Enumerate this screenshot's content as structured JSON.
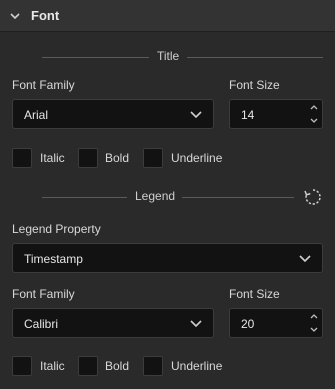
{
  "section": {
    "title": "Font"
  },
  "title_group": {
    "heading": "Title",
    "font_family_label": "Font Family",
    "font_family_value": "Arial",
    "font_size_label": "Font Size",
    "font_size_value": "14",
    "checkboxes": [
      {
        "label": "Italic",
        "checked": false
      },
      {
        "label": "Bold",
        "checked": false
      },
      {
        "label": "Underline",
        "checked": false
      }
    ]
  },
  "legend_group": {
    "heading": "Legend",
    "property_label": "Legend Property",
    "property_value": "Timestamp",
    "font_family_label": "Font Family",
    "font_family_value": "Calibri",
    "font_size_label": "Font Size",
    "font_size_value": "20",
    "checkboxes": [
      {
        "label": "Italic",
        "checked": false
      },
      {
        "label": "Bold",
        "checked": false
      },
      {
        "label": "Underline",
        "checked": false
      }
    ]
  },
  "icons": {
    "collapse": "chevron-down-icon",
    "select_caret": "chevron-down-icon",
    "spinner_up": "spin-up-icon",
    "spinner_down": "spin-down-icon",
    "reset": "refresh-icon"
  },
  "colors": {
    "background": "#2a2a2a",
    "header": "#333333",
    "field": "#121212",
    "text": "#dcdcdc"
  }
}
